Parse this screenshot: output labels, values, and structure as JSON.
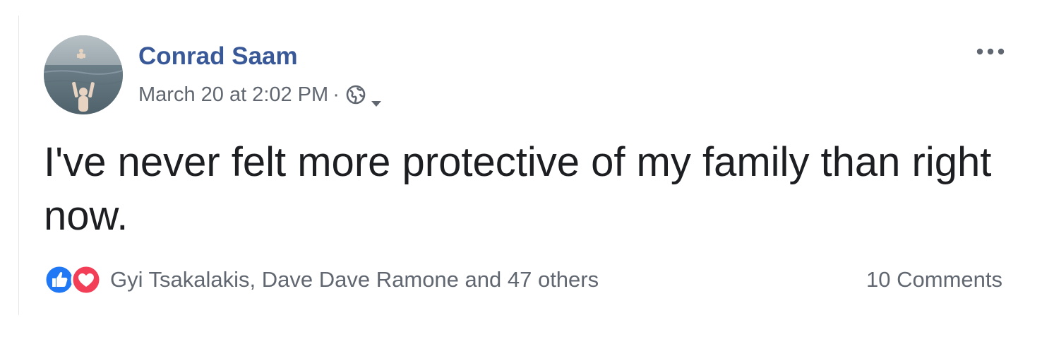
{
  "post": {
    "author": "Conrad Saam",
    "timestamp": "March 20 at 2:02 PM",
    "separator": "·",
    "privacy_icon": "globe-icon",
    "audience_caret_icon": "caret-down-icon",
    "options_icon": "more-horizontal-icon",
    "text": "I've never felt more protective of my family than right now.",
    "reactions": {
      "icons": [
        "like-icon",
        "love-icon"
      ],
      "summary": "Gyi Tsakalakis, Dave Dave Ramone and 47 others"
    },
    "comments_label": "10 Comments"
  },
  "colors": {
    "author_link": "#385898",
    "secondary_text": "#616770",
    "body_text": "#1c1e21",
    "like_blue": "#2078f4",
    "love_red": "#f33e58"
  }
}
